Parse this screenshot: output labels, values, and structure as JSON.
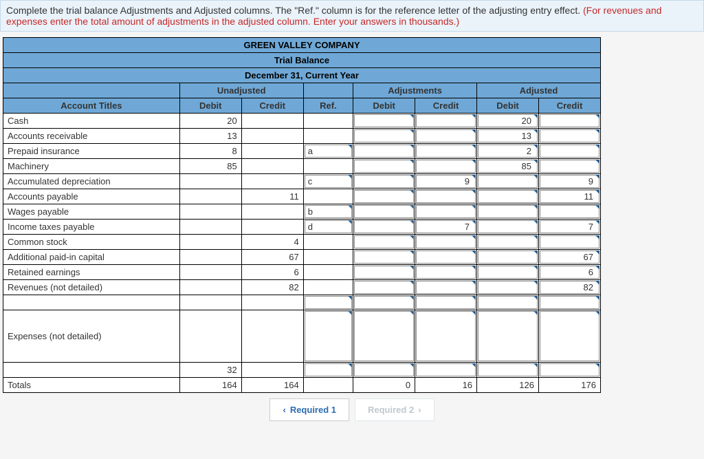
{
  "instructions": {
    "black": "Complete the trial balance Adjustments and Adjusted columns. The \"Ref.\" column is for the reference letter of the adjusting entry effect. ",
    "red": "(For revenues and expenses enter the total amount of adjustments in the adjusted column. Enter your answers in thousands.)"
  },
  "header": {
    "company": "GREEN VALLEY COMPANY",
    "title": "Trial Balance",
    "date": "December 31, Current Year"
  },
  "groups": {
    "unadjusted": "Unadjusted",
    "adjustments": "Adjustments",
    "adjusted": "Adjusted"
  },
  "cols": {
    "account": "Account Titles",
    "debit": "Debit",
    "credit": "Credit",
    "ref": "Ref."
  },
  "rows": [
    {
      "acct": "Cash",
      "uDr": "20",
      "uCr": "",
      "ref": "",
      "adjDr": "",
      "adjCr": "",
      "aDr": "20",
      "aCr": "",
      "hasRef": false
    },
    {
      "acct": "Accounts receivable",
      "uDr": "13",
      "uCr": "",
      "ref": "",
      "adjDr": "",
      "adjCr": "",
      "aDr": "13",
      "aCr": "",
      "hasRef": false
    },
    {
      "acct": "Prepaid insurance",
      "uDr": "8",
      "uCr": "",
      "ref": "a",
      "adjDr": "",
      "adjCr": "",
      "aDr": "2",
      "aCr": "",
      "hasRef": true
    },
    {
      "acct": "Machinery",
      "uDr": "85",
      "uCr": "",
      "ref": "",
      "adjDr": "",
      "adjCr": "",
      "aDr": "85",
      "aCr": "",
      "hasRef": false
    },
    {
      "acct": "Accumulated depreciation",
      "uDr": "",
      "uCr": "",
      "ref": "c",
      "adjDr": "",
      "adjCr": "9",
      "aDr": "",
      "aCr": "9",
      "hasRef": true
    },
    {
      "acct": "Accounts payable",
      "uDr": "",
      "uCr": "11",
      "ref": "",
      "adjDr": "",
      "adjCr": "",
      "aDr": "",
      "aCr": "11",
      "hasRef": false
    },
    {
      "acct": "Wages payable",
      "uDr": "",
      "uCr": "",
      "ref": "b",
      "adjDr": "",
      "adjCr": "",
      "aDr": "",
      "aCr": "",
      "hasRef": true
    },
    {
      "acct": "Income taxes payable",
      "uDr": "",
      "uCr": "",
      "ref": "d",
      "adjDr": "",
      "adjCr": "7",
      "aDr": "",
      "aCr": "7",
      "hasRef": true
    },
    {
      "acct": "Common stock",
      "uDr": "",
      "uCr": "4",
      "ref": "",
      "adjDr": "",
      "adjCr": "",
      "aDr": "",
      "aCr": "",
      "hasRef": false
    },
    {
      "acct": "Additional paid-in capital",
      "uDr": "",
      "uCr": "67",
      "ref": "",
      "adjDr": "",
      "adjCr": "",
      "aDr": "",
      "aCr": "67",
      "hasRef": false
    },
    {
      "acct": "Retained earnings",
      "uDr": "",
      "uCr": "6",
      "ref": "",
      "adjDr": "",
      "adjCr": "",
      "aDr": "",
      "aCr": "6",
      "hasRef": false
    },
    {
      "acct": "Revenues (not detailed)",
      "uDr": "",
      "uCr": "82",
      "ref": "",
      "adjDr": "",
      "adjCr": "",
      "aDr": "",
      "aCr": "82",
      "hasRef": false
    }
  ],
  "expensesLabel": "Expenses (not detailed)",
  "preTotal": {
    "uDr": "32"
  },
  "totals": {
    "label": "Totals",
    "uDr": "164",
    "uCr": "164",
    "adjDr": "0",
    "adjCr": "16",
    "aDr": "126",
    "aCr": "176"
  },
  "nav": {
    "prev": "Required 1",
    "next": "Required 2"
  }
}
